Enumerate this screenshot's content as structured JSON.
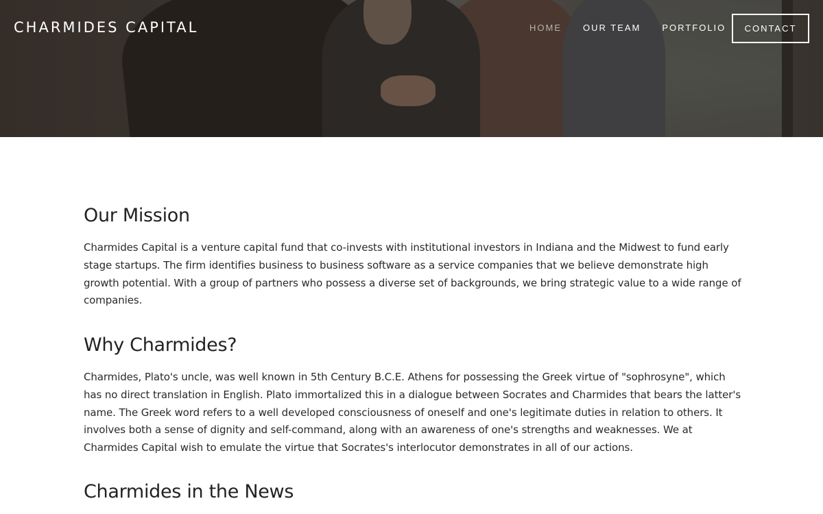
{
  "header": {
    "logo": "CHARMIDES CAPITAL",
    "nav": [
      {
        "label": "HOME",
        "active": true
      },
      {
        "label": "OUR TEAM",
        "active": false
      },
      {
        "label": "PORTFOLIO",
        "active": false
      }
    ],
    "contact_label": "CONTACT"
  },
  "hero": {
    "image_subject": "business-handshake-photo"
  },
  "main": {
    "mission_heading": "Our Mission",
    "mission_text": "Charmides Capital is a venture capital fund that co-invests with institutional investors in Indiana and the Midwest to fund early stage startups. The firm identifies business to business software as a service companies that we believe demonstrate high growth potential. With a group of partners who possess a diverse set of backgrounds, we bring strategic value to a wide range of companies.",
    "why_heading": "Why Charmides?",
    "why_text": "Charmides, Plato's uncle, was well known in 5th Century B.C.E. Athens for possessing the Greek virtue of \"sophrosyne\", which has no direct translation in English. Plato immortalized this in a dialogue between Socrates and Charmides that bears the latter's name. The Greek word refers to a well developed consciousness of oneself and one's legitimate duties in relation to others. It involves both a sense of dignity and self-command, along with an awareness of one's strengths and weaknesses. We at Charmides Capital wish to emulate the virtue that Socrates's interlocutor demonstrates in all of our actions.",
    "news_heading": "Charmides in the News"
  },
  "colors": {
    "text": "#222222",
    "nav_active": "#b9b4ae",
    "nav": "#ffffff",
    "background": "#ffffff"
  }
}
